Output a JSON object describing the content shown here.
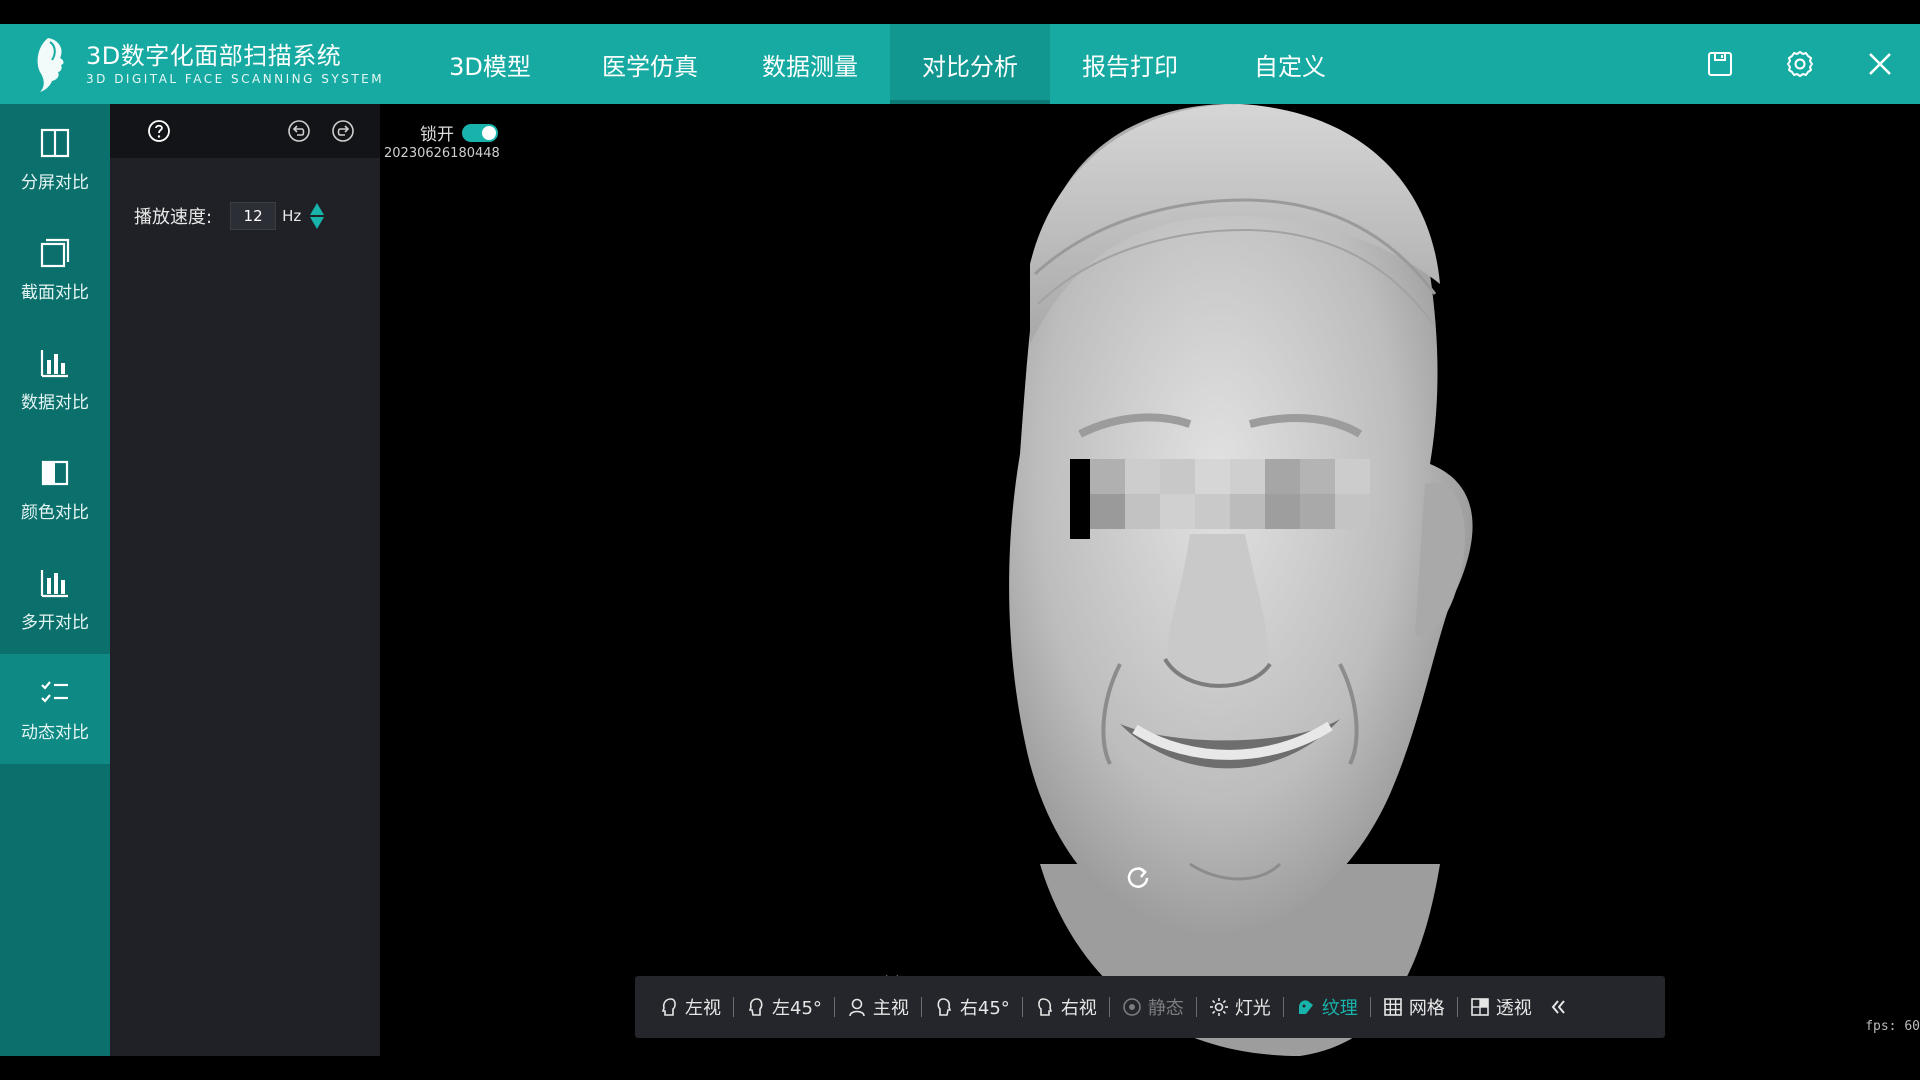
{
  "app": {
    "title": "3D数字化面部扫描系统",
    "subtitle": "3D DIGITAL FACE SCANNING SYSTEM",
    "accent": "#16aaa2"
  },
  "nav": [
    {
      "label": "3D模型"
    },
    {
      "label": "医学仿真"
    },
    {
      "label": "数据测量"
    },
    {
      "label": "对比分析",
      "active": true
    },
    {
      "label": "报告打印"
    },
    {
      "label": "自定义"
    }
  ],
  "header_actions": [
    "save-icon",
    "gear-icon",
    "close-icon"
  ],
  "sidebar": [
    {
      "label": "分屏对比",
      "icon": "split-screen-icon"
    },
    {
      "label": "截面对比",
      "icon": "section-icon"
    },
    {
      "label": "数据对比",
      "icon": "bar-chart-icon"
    },
    {
      "label": "颜色对比",
      "icon": "color-compare-icon"
    },
    {
      "label": "多开对比",
      "icon": "multi-chart-icon"
    },
    {
      "label": "动态对比",
      "icon": "checklist-icon",
      "active": true
    }
  ],
  "panel": {
    "speed_label": "播放速度:",
    "speed_value": "12",
    "speed_unit": "Hz"
  },
  "viewport": {
    "lock_label": "锁开",
    "lock_on": true,
    "scan_id": "20230626180448",
    "fps": "fps: 60"
  },
  "toolbar": [
    {
      "label": "左视",
      "icon": "head-left-icon"
    },
    {
      "label": "左45°",
      "icon": "head-left45-icon"
    },
    {
      "label": "主视",
      "icon": "person-front-icon"
    },
    {
      "label": "右45°",
      "icon": "head-right45-icon"
    },
    {
      "label": "右视",
      "icon": "head-right-icon"
    },
    {
      "label": "静态",
      "icon": "static-icon",
      "state": "disabled"
    },
    {
      "label": "灯光",
      "icon": "light-icon"
    },
    {
      "label": "纹理",
      "icon": "texture-icon",
      "state": "active"
    },
    {
      "label": "网格",
      "icon": "grid-icon"
    },
    {
      "label": "透视",
      "icon": "perspective-icon"
    }
  ]
}
